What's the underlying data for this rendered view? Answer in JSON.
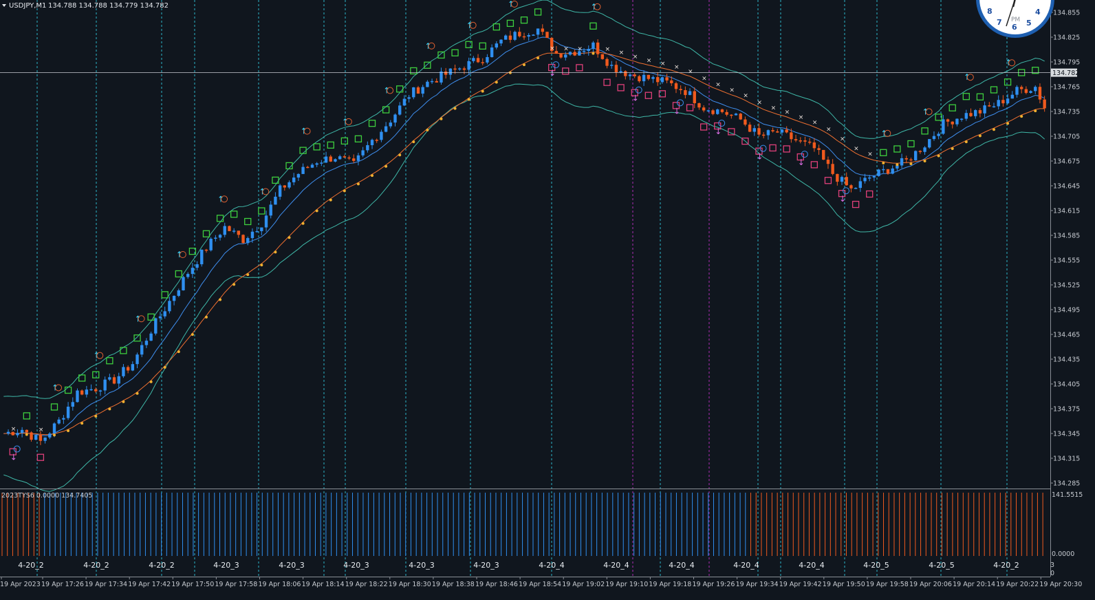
{
  "header": {
    "symbol": "USDJPY,M1",
    "ohlc": "134.788 134.788 134.779 134.782"
  },
  "subwindow": {
    "label": "2023TYS6 0.0000 134.7405",
    "scale_top": "141.5515",
    "scale_bottom": "0.0000"
  },
  "right_extra": [
    "3",
    "0"
  ],
  "clock": {
    "label": "PM",
    "numbers": [
      "8",
      "7",
      "6",
      "5",
      "4"
    ]
  },
  "colors": {
    "background": "#10161e",
    "bull": "#2f8ff0",
    "bear": "#f05a1e",
    "bb": "#3fb8a8",
    "mid": "#3f8ff0",
    "ma_slow": "#f07030",
    "vline": "#2fc8dc",
    "magenta": "#c030c8",
    "current_price": "#d8dce0"
  },
  "chart_data": {
    "type": "candlestick",
    "symbol": "USDJPY",
    "timeframe": "M1",
    "current_price": 134.782,
    "ylim": [
      134.278,
      134.852
    ],
    "y_ticks": [
      "134.855",
      "134.825",
      "134.795",
      "134.765",
      "134.735",
      "134.705",
      "134.675",
      "134.645",
      "134.615",
      "134.585",
      "134.555",
      "134.525",
      "134.495",
      "134.465",
      "134.435",
      "134.405",
      "134.375",
      "134.345",
      "134.315",
      "134.285"
    ],
    "x_ticks": [
      "19 Apr 2023",
      "19 Apr 17:26",
      "19 Apr 17:34",
      "19 Apr 17:42",
      "19 Apr 17:50",
      "19 Apr 17:58",
      "19 Apr 18:06",
      "19 Apr 18:14",
      "19 Apr 18:22",
      "19 Apr 18:30",
      "19 Apr 18:38",
      "19 Apr 18:46",
      "19 Apr 18:54",
      "19 Apr 19:02",
      "19 Apr 19:10",
      "19 Apr 19:18",
      "19 Apr 19:26",
      "19 Apr 19:34",
      "19 Apr 19:42",
      "19 Apr 19:50",
      "19 Apr 19:58",
      "19 Apr 20:06",
      "19 Apr 20:14",
      "19 Apr 20:22",
      "19 Apr 20:30"
    ],
    "session_labels": [
      "4-20_2",
      "4-20_2",
      "4-20_2",
      "4-20_3",
      "4-20_3",
      "4-20_3",
      "4-20_3",
      "4-20_3",
      "4-20_4",
      "4-20_4",
      "4-20_4",
      "4-20_4",
      "4-20_4",
      "4-20_5",
      "4-20_5",
      "4-20_2"
    ],
    "close_path": [
      [
        0,
        134.345
      ],
      [
        4,
        134.35
      ],
      [
        8,
        134.335
      ],
      [
        12,
        134.36
      ],
      [
        16,
        134.395
      ],
      [
        20,
        134.4
      ],
      [
        24,
        134.41
      ],
      [
        28,
        134.43
      ],
      [
        32,
        134.47
      ],
      [
        36,
        134.505
      ],
      [
        40,
        134.54
      ],
      [
        44,
        134.57
      ],
      [
        48,
        134.595
      ],
      [
        52,
        134.58
      ],
      [
        56,
        134.6
      ],
      [
        60,
        134.64
      ],
      [
        64,
        134.66
      ],
      [
        68,
        134.675
      ],
      [
        72,
        134.68
      ],
      [
        76,
        134.67
      ],
      [
        80,
        134.7
      ],
      [
        84,
        134.725
      ],
      [
        88,
        134.755
      ],
      [
        92,
        134.77
      ],
      [
        96,
        134.78
      ],
      [
        100,
        134.79
      ],
      [
        104,
        134.8
      ],
      [
        108,
        134.82
      ],
      [
        112,
        134.83
      ],
      [
        116,
        134.835
      ],
      [
        120,
        134.805
      ],
      [
        124,
        134.808
      ],
      [
        128,
        134.815
      ],
      [
        132,
        134.79
      ],
      [
        136,
        134.78
      ],
      [
        140,
        134.775
      ],
      [
        144,
        134.77
      ],
      [
        148,
        134.76
      ],
      [
        152,
        134.74
      ],
      [
        156,
        134.735
      ],
      [
        160,
        134.725
      ],
      [
        164,
        134.705
      ],
      [
        168,
        134.71
      ],
      [
        172,
        134.7
      ],
      [
        176,
        134.69
      ],
      [
        180,
        134.66
      ],
      [
        184,
        134.64
      ],
      [
        188,
        134.655
      ],
      [
        192,
        134.665
      ],
      [
        196,
        134.675
      ],
      [
        200,
        134.695
      ],
      [
        204,
        134.72
      ],
      [
        208,
        134.73
      ],
      [
        212,
        134.735
      ],
      [
        216,
        134.745
      ],
      [
        220,
        134.76
      ],
      [
        224,
        134.765
      ],
      [
        226,
        134.74
      ]
    ],
    "series": [
      {
        "name": "USDJPY,M1"
      }
    ],
    "subwindow": {
      "name": "2023TYS6",
      "values": [
        0.0,
        134.7405
      ],
      "range": [
        0.0,
        141.5515
      ],
      "bear_bar_ranges": [
        [
          0,
          7
        ],
        [
          141,
          196
        ]
      ]
    }
  }
}
